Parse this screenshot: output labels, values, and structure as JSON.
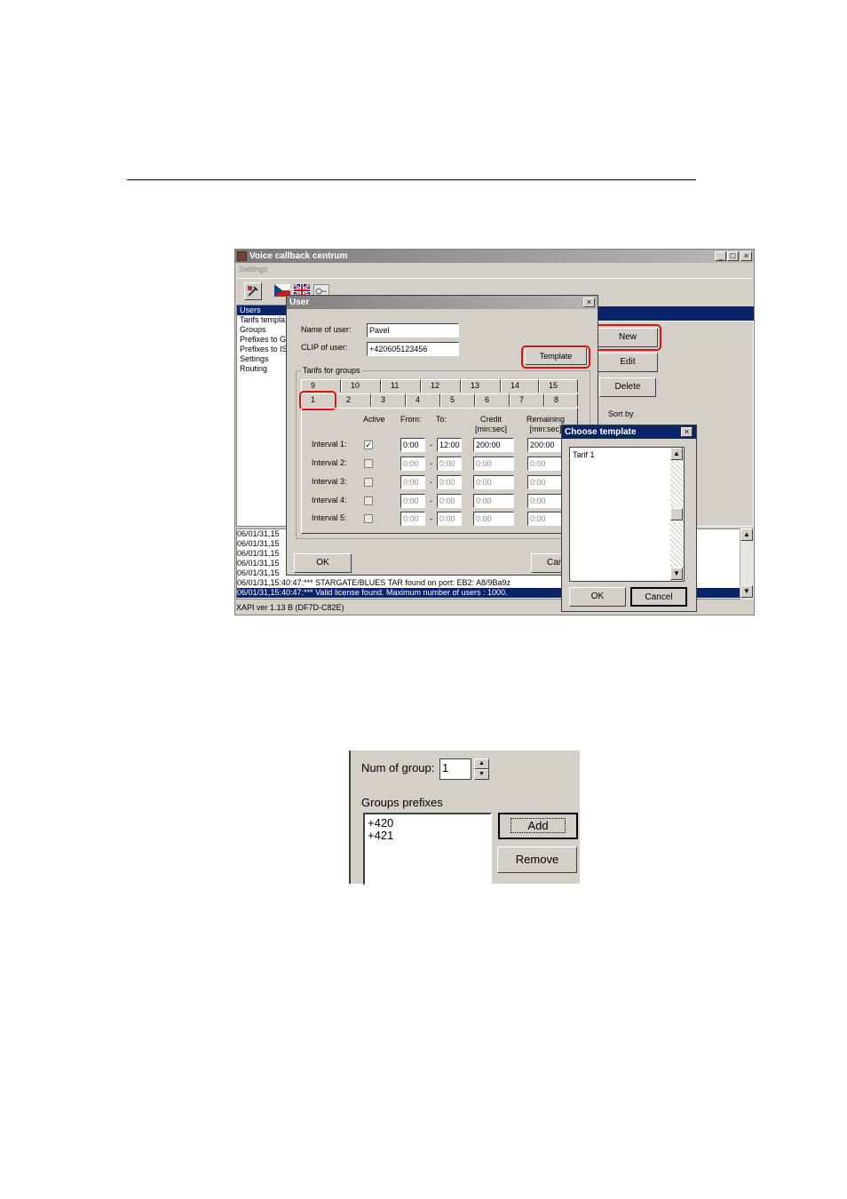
{
  "main_window": {
    "title": "Voice callback centrum",
    "menu_settings": "Settings",
    "controls": {
      "minimize": "_",
      "maximize": "□",
      "close": "×"
    },
    "nav_items": [
      "Users",
      "Tarifs templa",
      "Groups",
      "Prefixes to G",
      "Prefixes to IS",
      "Settings",
      "Routing"
    ],
    "buttons": {
      "new": "New",
      "edit": "Edit",
      "delete": "Delete"
    },
    "sort_by": "Sort by",
    "log_lines": [
      "06/01/31,15",
      "06/01/31,15",
      "06/01/31,15",
      "06/01/31,15",
      "06/01/31,15",
      "06/01/31,15:40:47:*** STARGATE/BLUES TAR found on port: EB2: A8/9Ba9z",
      "06/01/31,15:40:47:*** Valid license found. Maximum number of users : 1000."
    ],
    "status": "XAPI ver 1.13 B (DF7D-C82E)"
  },
  "user_dialog": {
    "title": "User",
    "close": "×",
    "name_label": "Name of user:",
    "name_value": "Pavel",
    "clip_label": "CLIP of user:",
    "clip_value": "+420605123456",
    "template_button": "Template",
    "tariffs_legend": "Tarifs for groups",
    "tabs_row1": [
      "9",
      "10",
      "11",
      "12",
      "13",
      "14",
      "15"
    ],
    "tabs_row2": [
      "1",
      "2",
      "3",
      "4",
      "5",
      "6",
      "7",
      "8"
    ],
    "headers": {
      "active": "Active",
      "from": "From:",
      "to": "To:",
      "credit": "Credit\n[min:sec]",
      "remaining": "Remaining\n[min:sec]"
    },
    "intervals": [
      {
        "label": "Interval 1:",
        "active": true,
        "from": "0:00",
        "to": "12:00",
        "credit": "200:00",
        "remaining": "200:00"
      },
      {
        "label": "Interval 2:",
        "active": false,
        "from": "0:00",
        "to": "0:00",
        "credit": "0:00",
        "remaining": "0:00"
      },
      {
        "label": "Interval 3:",
        "active": false,
        "from": "0:00",
        "to": "0:00",
        "credit": "0:00",
        "remaining": "0:00"
      },
      {
        "label": "Interval 4:",
        "active": false,
        "from": "0:00",
        "to": "0:00",
        "credit": "0:00",
        "remaining": "0:00"
      },
      {
        "label": "Interval 5:",
        "active": false,
        "from": "0:00",
        "to": "0:00",
        "credit": "0:00",
        "remaining": "0:00"
      }
    ],
    "dash": "-",
    "ok": "OK",
    "cancel": "Can"
  },
  "choose_template": {
    "title": "Choose template",
    "close": "×",
    "items": [
      "Tarif 1"
    ],
    "ok": "OK",
    "cancel": "Cancel"
  },
  "groups_panel": {
    "num_label": "Num of group:",
    "num_value": "1",
    "prefixes_label": "Groups prefixes",
    "prefixes": [
      "+420",
      "+421"
    ],
    "add": "Add",
    "remove": "Remove"
  },
  "colors": {
    "highlight": "#e01010",
    "selection": "#0a246a",
    "face": "#d4d0c8"
  }
}
